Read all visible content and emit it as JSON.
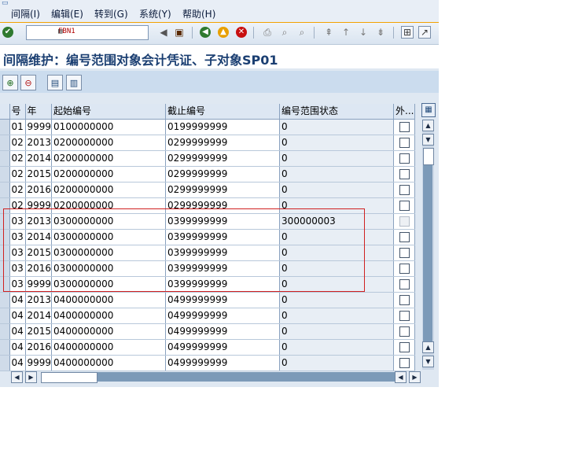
{
  "menu": [
    {
      "label": "间隔(I)"
    },
    {
      "label": "编辑(E)"
    },
    {
      "label": "转到(G)"
    },
    {
      "label": "系统(Y)"
    },
    {
      "label": "帮助(H)"
    }
  ],
  "command_field": {
    "value": "FBN1"
  },
  "page_title": "间隔维护：编号范围对象会计凭证、子对象SP01",
  "table": {
    "headers": [
      "号",
      "年",
      "起始编号",
      "截止编号",
      "编号范围状态",
      "外..."
    ],
    "rows": [
      {
        "no": "01",
        "year": "9999",
        "from": "0100000000",
        "to": "0199999999",
        "status": "0"
      },
      {
        "no": "02",
        "year": "2013",
        "from": "0200000000",
        "to": "0299999999",
        "status": "0"
      },
      {
        "no": "02",
        "year": "2014",
        "from": "0200000000",
        "to": "0299999999",
        "status": "0"
      },
      {
        "no": "02",
        "year": "2015",
        "from": "0200000000",
        "to": "0299999999",
        "status": "0"
      },
      {
        "no": "02",
        "year": "2016",
        "from": "0200000000",
        "to": "0299999999",
        "status": "0"
      },
      {
        "no": "02",
        "year": "9999",
        "from": "0200000000",
        "to": "0299999999",
        "status": "0"
      },
      {
        "no": "03",
        "year": "2013",
        "from": "0300000000",
        "to": "0399999999",
        "status": "300000003",
        "disabled": true
      },
      {
        "no": "03",
        "year": "2014",
        "from": "0300000000",
        "to": "0399999999",
        "status": "0"
      },
      {
        "no": "03",
        "year": "2015",
        "from": "0300000000",
        "to": "0399999999",
        "status": "0"
      },
      {
        "no": "03",
        "year": "2016",
        "from": "0300000000",
        "to": "0399999999",
        "status": "0"
      },
      {
        "no": "03",
        "year": "9999",
        "from": "0300000000",
        "to": "0399999999",
        "status": "0"
      },
      {
        "no": "04",
        "year": "2013",
        "from": "0400000000",
        "to": "0499999999",
        "status": "0"
      },
      {
        "no": "04",
        "year": "2014",
        "from": "0400000000",
        "to": "0499999999",
        "status": "0"
      },
      {
        "no": "04",
        "year": "2015",
        "from": "0400000000",
        "to": "0499999999",
        "status": "0"
      },
      {
        "no": "04",
        "year": "2016",
        "from": "0400000000",
        "to": "0499999999",
        "status": "0"
      },
      {
        "no": "04",
        "year": "9999",
        "from": "0400000000",
        "to": "0499999999",
        "status": "0"
      }
    ]
  },
  "icons": {
    "enter": "check-icon",
    "save": "save-icon",
    "back": "back-icon",
    "exit": "exit-icon",
    "cancel": "cancel-icon"
  },
  "colors": {
    "accent": "#f2a100",
    "title": "#1b3f72",
    "highlight": "#d02020"
  }
}
